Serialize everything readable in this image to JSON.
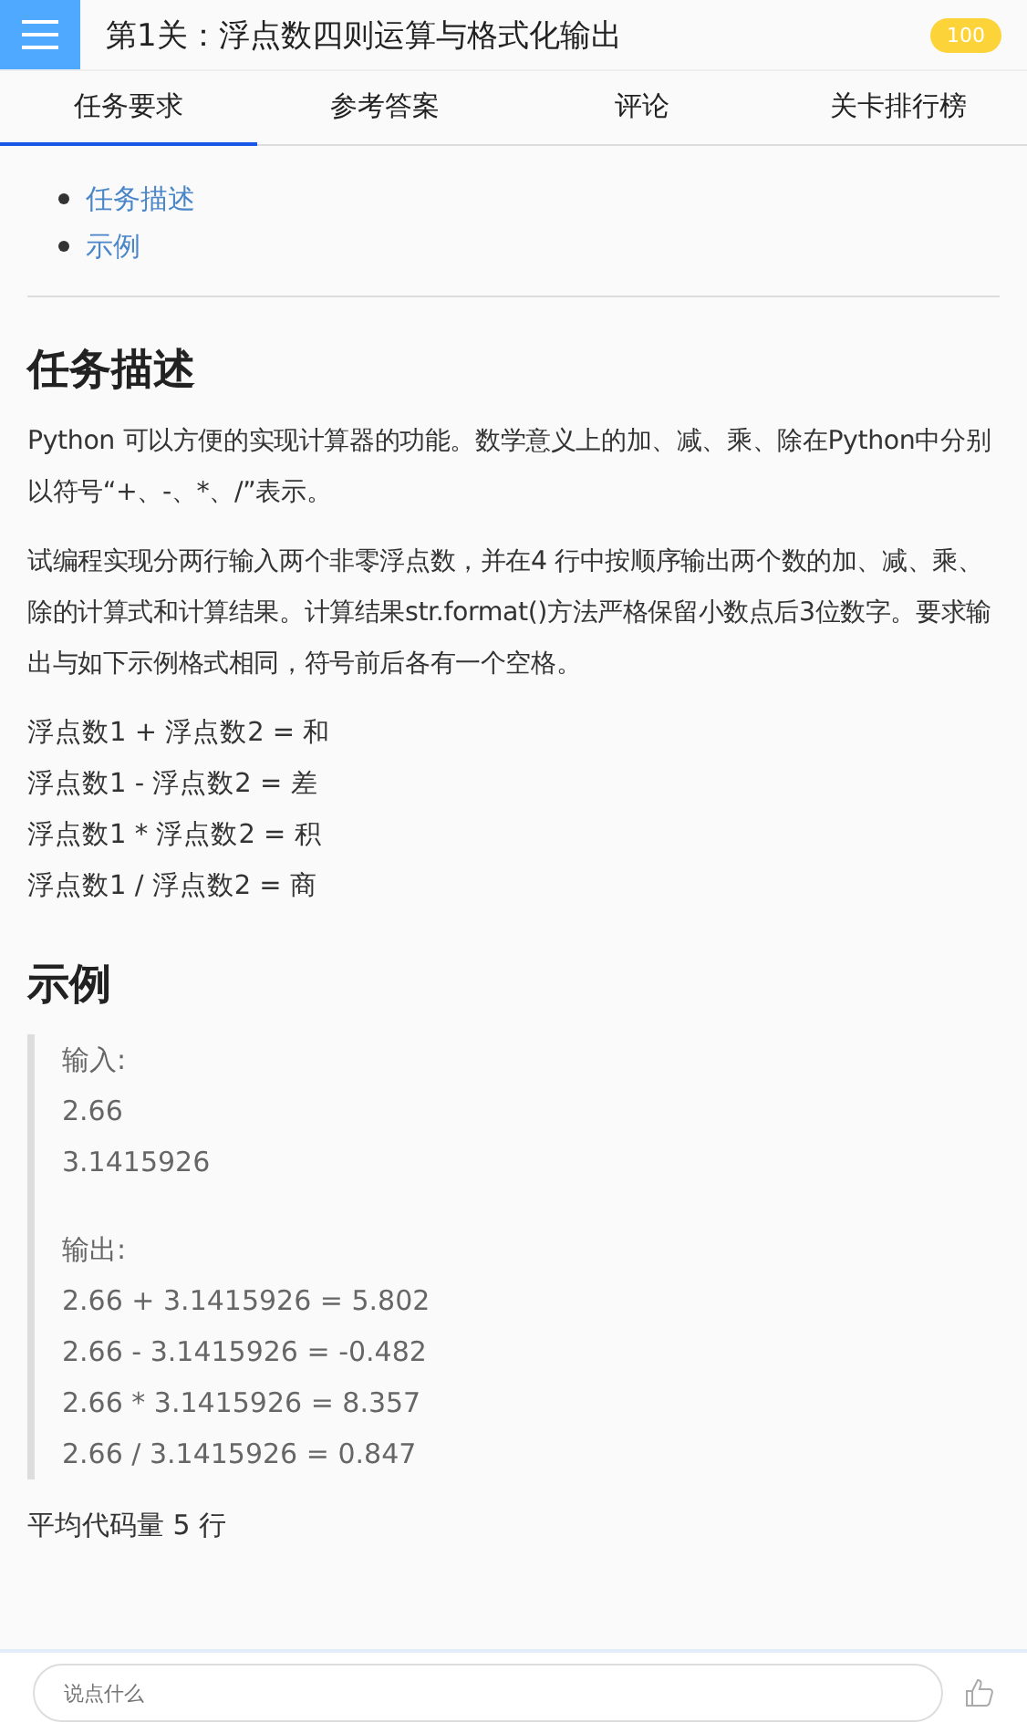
{
  "header": {
    "title": "第1关：浮点数四则运算与格式化输出",
    "score": "100"
  },
  "tabs": [
    {
      "label": "任务要求",
      "selected": true
    },
    {
      "label": "参考答案",
      "selected": false
    },
    {
      "label": "评论",
      "selected": false
    },
    {
      "label": "关卡排行榜",
      "selected": false
    }
  ],
  "toc": [
    "任务描述",
    "示例"
  ],
  "sections": [
    {
      "heading": "任务描述",
      "paragraphs": [
        "Python 可以方便的实现计算器的功能。数学意义上的加、减、乘、除在Python中分别以符号“+、-、*、/”表示。",
        "试编程实现分两行输入两个非零浮点数，并在4 行中按顺序输出两个数的加、减、乘、除的计算式和计算结果。计算结果str.format()方法严格保留小数点后3位数字。要求输出与如下示例格式相同，符号前后各有一个空格。"
      ],
      "lines": [
        "浮点数1 + 浮点数2 = 和",
        "浮点数1 - 浮点数2 = 差",
        "浮点数1 * 浮点数2 = 积",
        "浮点数1 / 浮点数2 = 商"
      ]
    },
    {
      "heading": "示例",
      "example": {
        "input_label": "输入:",
        "input_lines": [
          "2.66",
          "3.1415926"
        ],
        "output_label": "输出:",
        "output_lines": [
          "2.66 + 3.1415926 = 5.802",
          "2.66 - 3.1415926 = -0.482",
          "2.66 * 3.1415926 = 8.357",
          "2.66 / 3.1415926 = 0.847"
        ]
      }
    }
  ],
  "footnote": "平均代码量 5 行",
  "comment_box": {
    "placeholder": "说点什么"
  }
}
